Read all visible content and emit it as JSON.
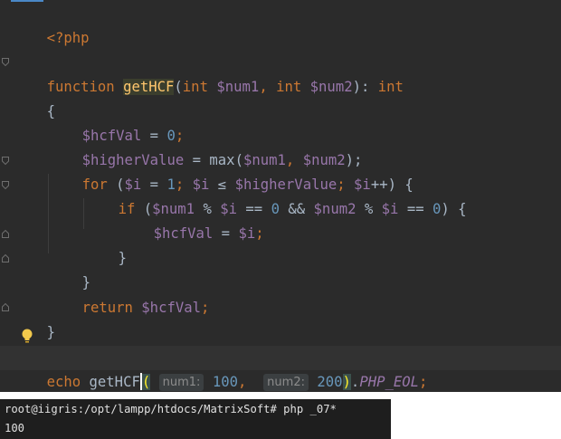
{
  "editor": {
    "lines": {
      "open_tag": "<?php",
      "fn_kw": "function",
      "fn_name": "getHCF",
      "fn_p1": "(",
      "fn_int1": "int",
      "fn_num1": "$num1",
      "fn_comma": ", ",
      "fn_int2": "int",
      "fn_num2": "$num2",
      "fn_close": "): ",
      "fn_ret": "int",
      "brace_open": "{",
      "l1_var": "$hcfVal",
      "l1_eq": " = ",
      "l1_num": "0",
      "l1_semi": ";",
      "l2_var": "$higherValue",
      "l2_eq": " = max(",
      "l2_num1": "$num1",
      "l2_comma": ", ",
      "l2_num2": "$num2",
      "l2_end": ");",
      "for_kw": "for",
      "for_open": " (",
      "for_i1": "$i",
      "for_eq": " = ",
      "for_one": "1",
      "for_semi1": "; ",
      "for_i2": "$i",
      "for_le": " ≤ ",
      "for_hv": "$higherValue",
      "for_semi2": "; ",
      "for_i3": "$i",
      "for_inc": "++) {",
      "if_kw": "if",
      "if_open": " (",
      "if_num1": "$num1",
      "if_mod1": " % ",
      "if_i1": "$i",
      "if_eq1": " == ",
      "if_zero1": "0",
      "if_and": " && ",
      "if_num2": "$num2",
      "if_mod2": " % ",
      "if_i2": "$i",
      "if_eq2": " == ",
      "if_zero2": "0",
      "if_close": ") {",
      "assign_var": "$hcfVal",
      "assign_eq": " = ",
      "assign_i": "$i",
      "assign_semi": ";",
      "close_if": "}",
      "close_for": "}",
      "return_kw": "return",
      "return_var": "$hcfVal",
      "return_semi": ";",
      "brace_close": "}",
      "echo_kw": "echo",
      "call_name": "getHCF",
      "call_open": "(",
      "hint1_label": "num1:",
      "hint1_val": "100",
      "call_comma": ", ",
      "hint2_label": "num2:",
      "hint2_val": "200",
      "call_close": ")",
      "call_dot": ".",
      "eol_const": "PHP_EOL",
      "call_semi": ";"
    }
  },
  "terminal": {
    "prompt_line": "root@iigris:/opt/lampp/htdocs/MatrixSoft# php _07*",
    "output_line": "100"
  },
  "colors": {
    "editor_bg": "#2b2b2b",
    "keyword": "#cc7832",
    "variable": "#9876aa",
    "number": "#6897bb",
    "function": "#ffc66d",
    "terminal_bg": "#1e1e1e"
  },
  "icons": {
    "intention": "lightbulb-icon",
    "fold": "fold-marker-icon"
  }
}
